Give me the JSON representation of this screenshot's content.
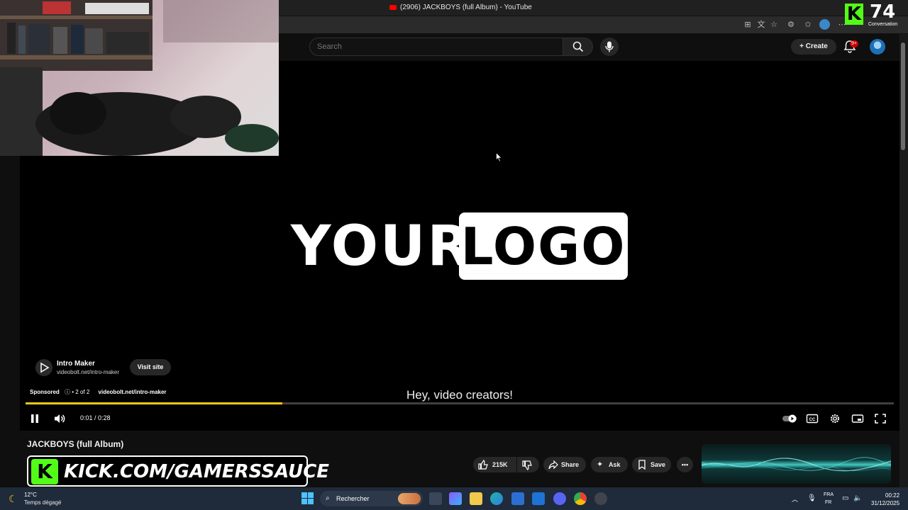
{
  "browser": {
    "window_title": "(2906) JACKBOYS (full Album) - YouTube"
  },
  "youtube_header": {
    "search_placeholder": "Search",
    "create_label": "Create",
    "notification_count": "9+"
  },
  "player": {
    "logo_word_1": "YOUR",
    "logo_word_2": "LOGO",
    "caption": "Hey, video creators!",
    "ad": {
      "advertiser": "Intro Maker",
      "url": "videobolt.net/intro-maker",
      "visit_label": "Visit site",
      "sponsored_label": "Sponsored",
      "ad_count": "2 of 2",
      "info_url": "videobolt.net/intro-maker"
    },
    "time": "0:01 / 0:28",
    "progress_fraction": 0.296
  },
  "video": {
    "title": "JACKBOYS (full Album)",
    "like_count": "215K",
    "share_label": "Share",
    "ask_label": "Ask",
    "save_label": "Save"
  },
  "overlay": {
    "kick_banner_text": "KICK.COM/GAMERSSAUCE",
    "kick_letter": "K",
    "counter_value": "74",
    "counter_label": "Conversation"
  },
  "taskbar": {
    "weather_temp": "12°C",
    "weather_desc": "Temps dégagé",
    "search_label": "Rechercher",
    "lang_1": "FRA",
    "lang_2": "FR",
    "time": "00:22",
    "date": "31/12/2025"
  },
  "colors": {
    "progress": "#f5c518",
    "kick_green": "#53fc18",
    "youtube_red": "#ff0000"
  }
}
